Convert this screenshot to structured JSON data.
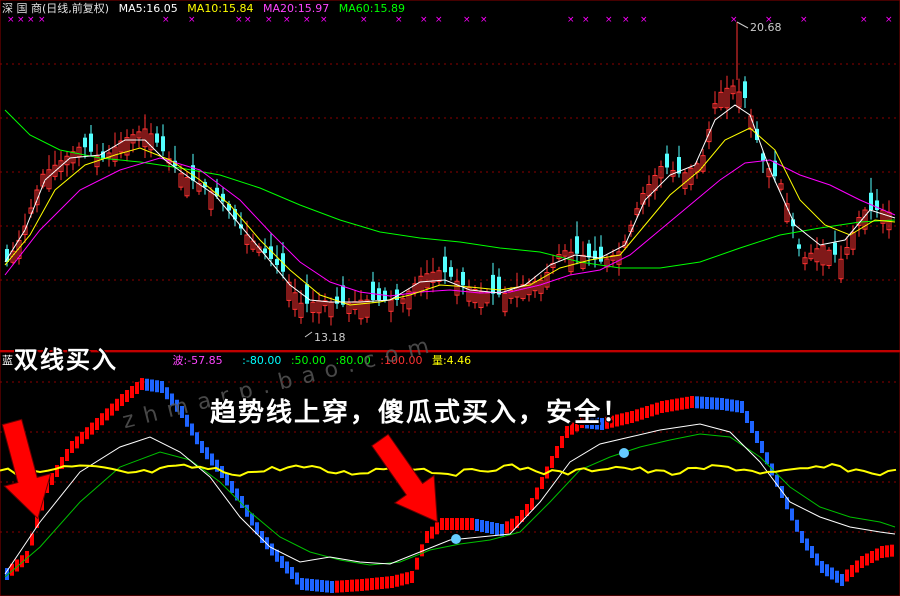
{
  "main_legend": {
    "title": "深 国 商(日线,前复权)",
    "ma5": "MA5:16.05",
    "ma10": "MA10:15.84",
    "ma20": "MA20:15.97",
    "ma60": "MA60:15.89"
  },
  "price_labels": {
    "high": "20.68",
    "low": "13.18"
  },
  "indicator_legend": {
    "name": "蓝",
    "wave": "波:-57.85",
    "l1": ":-80.00",
    "l2": ":50.00",
    "l3": ":80.00",
    "l4": ":100.00",
    "vol": "量:4.46"
  },
  "captions": {
    "dual_line_buy": "双线买入",
    "trend_cross": "趋势线上穿，傻瓜式买入，安全！"
  },
  "watermark": "zhmarp.bao.com",
  "colors": {
    "background": "#000000",
    "up_candle": "#ff3232",
    "down_candle": "#54ffff",
    "ma5": "#ffffff",
    "ma10": "#ffff00",
    "ma20": "#ff00ff",
    "ma60": "#00ff00",
    "grid": "#8b0000",
    "ind_up": "#ff0000",
    "ind_down": "#1e64ff",
    "arrow": "#ff0000"
  }
}
